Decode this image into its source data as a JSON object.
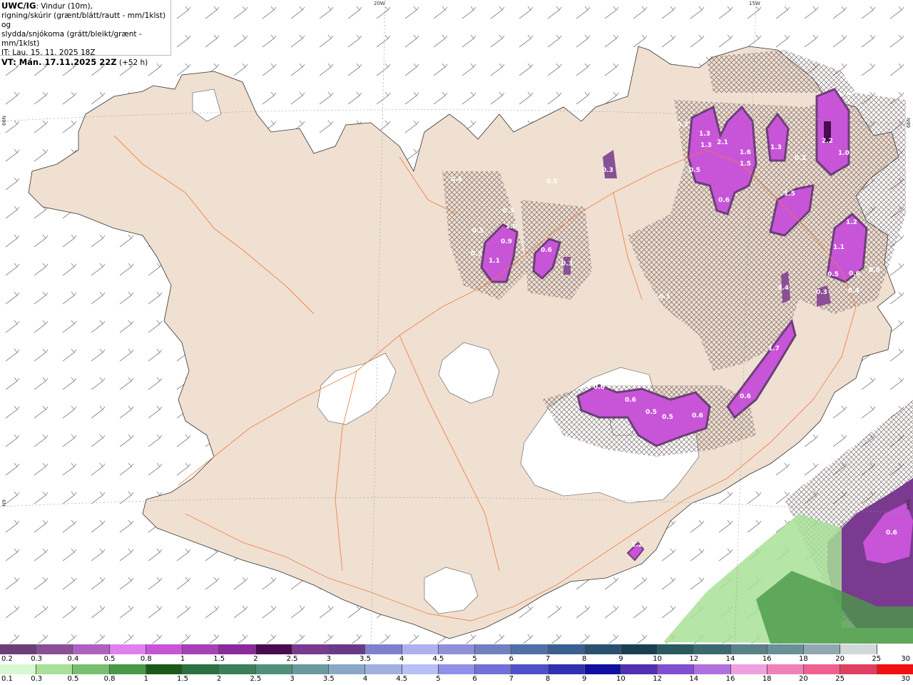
{
  "title": {
    "brand": "UWC/IG",
    "line1": ": Vindur (10m),",
    "line2": "rigning/skúrir (grænt/blátt/rautt - mm/1klst) og",
    "line3": "slydda/snjókoma (grátt/bleikt/grænt - mm/1klst)",
    "it": "IT: Lau. 15. 11. 2025 18Z",
    "vt": "VT: Mán. 17.11.2025 22Z",
    "vt_offset": "(+52 h)"
  },
  "coords": {
    "top_left": "20W",
    "top_right": "15W",
    "left_upper": "66N",
    "left_lower": "N9",
    "right_upper": "66N",
    "right_lower": "64N"
  },
  "precip_labels": [
    "0.3",
    "1.3",
    "1.3",
    "2.1",
    "1.6",
    "1.5",
    "1.3",
    "0.3",
    "2.2",
    "1.0",
    "0.5",
    "0.6",
    "0.3",
    "0.5",
    "0.4",
    "0.5",
    "1.0",
    "0.3",
    "0.9",
    "0.3",
    "1.1",
    "0.6",
    "0.3",
    "1.5",
    "1.2",
    "1.1",
    "0.5",
    "0.6",
    "0.5",
    "0.3",
    "0.4",
    "0.4",
    "0.1",
    "1.7",
    "0.6",
    "0.6",
    "0.6",
    "0.5",
    "0.5",
    "0.6",
    "1.2",
    "0.6"
  ],
  "legend_top": {
    "colors": [
      "#6b3f78",
      "#8a4f96",
      "#b060c0",
      "#e07ff0",
      "#c855d8",
      "#a840b8",
      "#8c2a9c",
      "#4a0a50",
      "#7a3a90",
      "#6a3a8a",
      "#8080d0",
      "#b0b0f0",
      "#9090d8",
      "#7080c0",
      "#5070a8",
      "#3a6090",
      "#2a5070",
      "#1a4050",
      "#2a5a60",
      "#3a6a70",
      "#5a8088",
      "#6a9098",
      "#90a8b0",
      "#d0d8d8",
      "#ffffff"
    ],
    "values": [
      "0.2",
      "0.3",
      "0.4",
      "0.5",
      "0.8",
      "1",
      "1.5",
      "2",
      "2.5",
      "3",
      "3.5",
      "4",
      "4.5",
      "5",
      "6",
      "7",
      "8",
      "9",
      "10",
      "12",
      "14",
      "16",
      "18",
      "20",
      "25",
      "30"
    ]
  },
  "legend_bottom": {
    "colors": [
      "#d8f8d0",
      "#a8e098",
      "#78c070",
      "#4a9848",
      "#1a5a18",
      "#2a7040",
      "#3a8058",
      "#50907a",
      "#6a9aa0",
      "#8aa8c8",
      "#a0b0e0",
      "#b8c0f8",
      "#9090e8",
      "#7070d8",
      "#5050c8",
      "#3030b0",
      "#1010a0",
      "#5030b0",
      "#8050d0",
      "#b070e0",
      "#f0a0e0",
      "#f080b8",
      "#f06090",
      "#e04060",
      "#f01010"
    ],
    "values": [
      "0.1",
      "0.3",
      "0.5",
      "0.8",
      "1",
      "1.5",
      "2",
      "2.5",
      "3",
      "3.5",
      "4",
      "4.5",
      "5",
      "6",
      "7",
      "8",
      "9",
      "10",
      "12",
      "14",
      "16",
      "18",
      "20",
      "25",
      "30"
    ]
  }
}
